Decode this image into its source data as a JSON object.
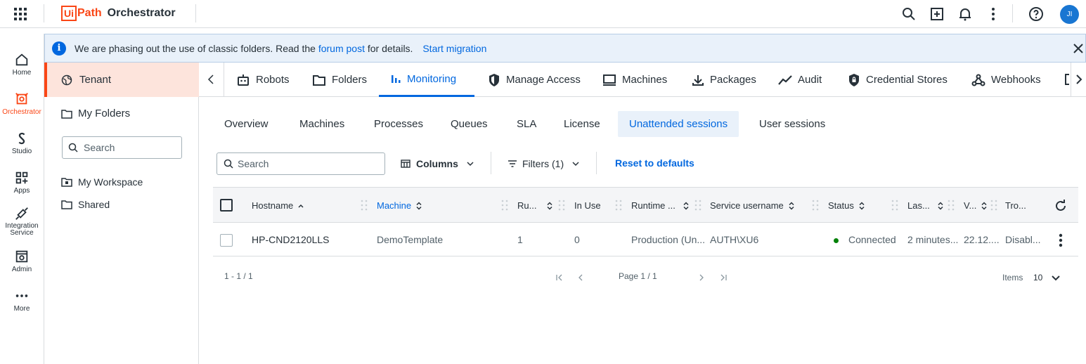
{
  "topbar": {
    "logo_box": "Ui",
    "logo_path": "Path",
    "product": "Orchestrator",
    "avatar_initials": "JI",
    "icons": [
      "apps-icon",
      "search-icon",
      "add-icon",
      "bell-icon",
      "more-vert-icon",
      "help-icon"
    ]
  },
  "leftnav": {
    "items": [
      {
        "label": "Home",
        "icon": "home-icon"
      },
      {
        "label": "Orchestrator",
        "icon": "orchestrator-icon",
        "active": true
      },
      {
        "label": "Studio",
        "icon": "studio-icon"
      },
      {
        "label": "Apps",
        "icon": "apps-grid-icon"
      },
      {
        "label": "Integration Service",
        "icon": "integration-icon"
      },
      {
        "label": "Admin",
        "icon": "admin-icon"
      },
      {
        "label": "More",
        "icon": "more-horiz-icon"
      }
    ]
  },
  "banner": {
    "text_before": "We are phasing out the use of classic folders. Read the ",
    "link": "forum post",
    "text_after": " for details.",
    "action": "Start migration"
  },
  "folders": {
    "tenant": "Tenant",
    "my_folders": "My Folders",
    "search_placeholder": "Search",
    "items": [
      "My Workspace",
      "Shared"
    ]
  },
  "tabs": [
    {
      "label": "Robots",
      "icon": "robot-icon"
    },
    {
      "label": "Folders",
      "icon": "folder-icon"
    },
    {
      "label": "Monitoring",
      "icon": "bar-chart-icon",
      "active": true
    },
    {
      "label": "Manage Access",
      "icon": "shield-icon"
    },
    {
      "label": "Machines",
      "icon": "monitor-icon"
    },
    {
      "label": "Packages",
      "icon": "download-icon"
    },
    {
      "label": "Audit",
      "icon": "trend-icon"
    },
    {
      "label": "Credential Stores",
      "icon": "shield-lock-icon"
    },
    {
      "label": "Webhooks",
      "icon": "webhook-icon"
    }
  ],
  "subtabs": [
    "Overview",
    "Machines",
    "Processes",
    "Queues",
    "SLA",
    "License",
    "Unattended sessions",
    "User sessions"
  ],
  "subtabs_active": "Unattended sessions",
  "toolbar": {
    "search_placeholder": "Search",
    "columns_label": "Columns",
    "filters_label": "Filters (1)",
    "reset_label": "Reset to defaults"
  },
  "grid": {
    "headers": [
      "Hostname",
      "Machine",
      "Ru...",
      "In Use",
      "Runtime ...",
      "Service username",
      "Status",
      "Las...",
      "V...",
      "Tro..."
    ],
    "rows": [
      {
        "hostname": "HP-CND2120LLS",
        "machine": "DemoTemplate",
        "runtimes": "1",
        "in_use": "0",
        "runtime_type": "Production (Un...",
        "service_username": "AUTH\\XU6",
        "status": "Connected",
        "last": "2 minutes...",
        "version": "22.12....",
        "troubleshooting": "Disabl..."
      }
    ],
    "status_color": "#038108"
  },
  "pagination": {
    "range": "1 - 1 / 1",
    "page": "Page 1 / 1",
    "items_label": "Items",
    "items_value": "10"
  },
  "colors": {
    "brand": "#fa4616",
    "accent": "#0067df"
  }
}
